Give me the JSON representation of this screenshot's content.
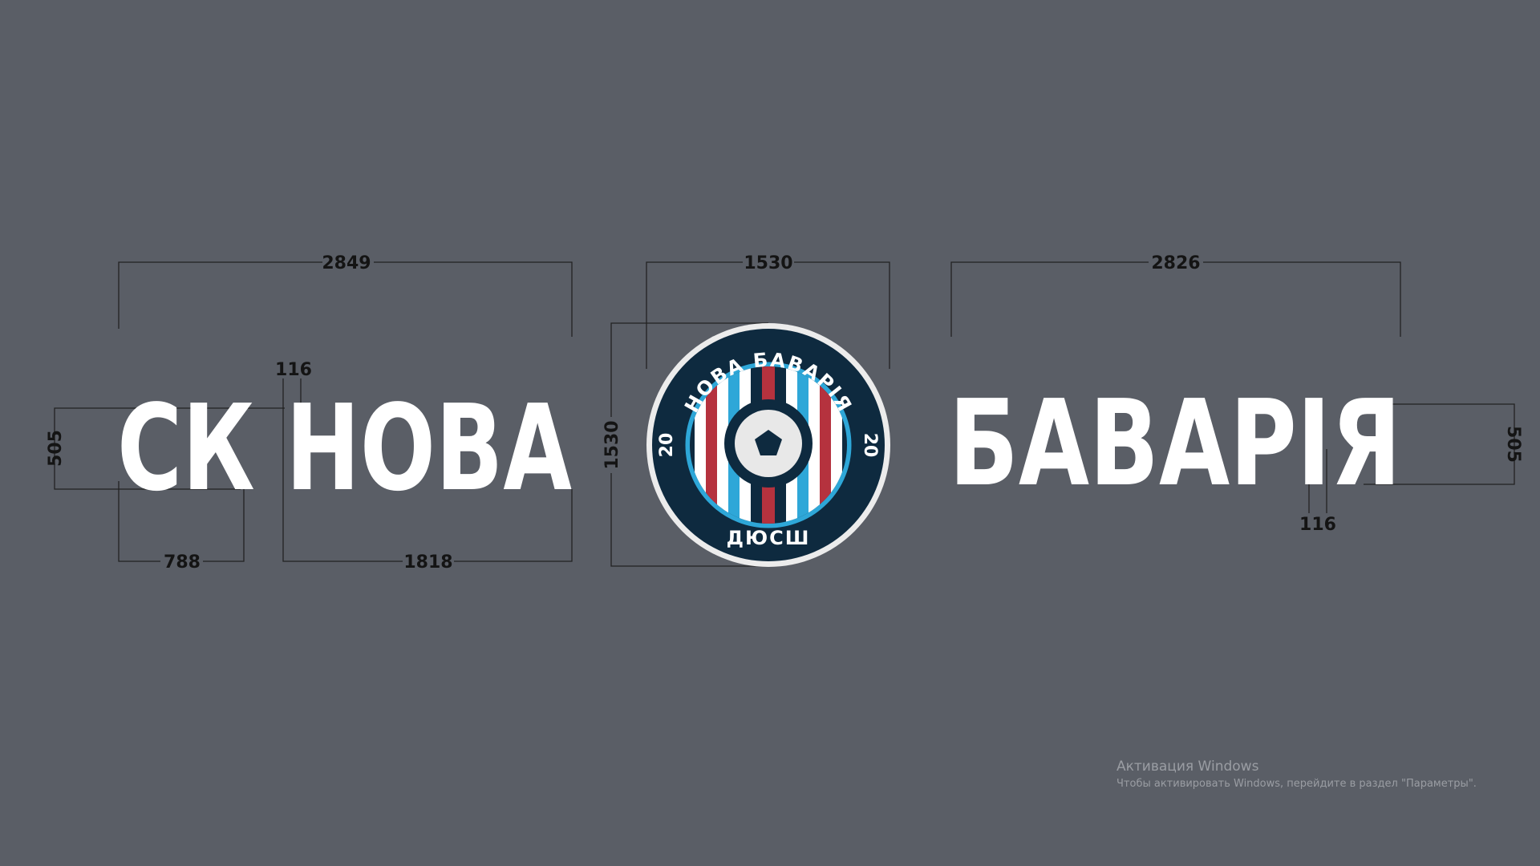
{
  "colors": {
    "background": "#5a5e66",
    "lettering": "#ffffff",
    "dimension_lines": "#222222",
    "crest_navy": "#0e2a3f",
    "crest_blue": "#2ea7d8",
    "crest_red": "#b5323e",
    "crest_ring": "#ececec"
  },
  "sign": {
    "left_text": "СК НОВА",
    "right_text": "БАВАРІЯ"
  },
  "crest": {
    "top_arc": "НОВА БАВАРІЯ",
    "year_left": "20",
    "year_right": "20",
    "bottom_text": "ДЮСШ"
  },
  "dimensions": {
    "left_total_width": "2849",
    "left_letter_height": "505",
    "stroke_left": "116",
    "sk_width": "788",
    "nova_width": "1818",
    "logo_width": "1530",
    "logo_height": "1530",
    "right_total_width": "2826",
    "right_letter_height": "505",
    "stroke_right": "116"
  },
  "watermark": {
    "title": "Активация Windows",
    "subtitle": "Чтобы активировать Windows, перейдите в раздел \"Параметры\"."
  }
}
